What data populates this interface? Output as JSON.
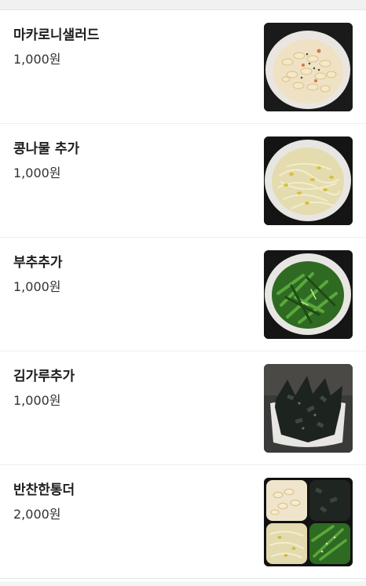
{
  "menu": {
    "items": [
      {
        "name": "마카로니샐러드",
        "price": "1,000원",
        "image": "macaroni-salad-photo"
      },
      {
        "name": "콩나물 추가",
        "price": "1,000원",
        "image": "bean-sprouts-photo"
      },
      {
        "name": "부추추가",
        "price": "1,000원",
        "image": "chives-photo"
      },
      {
        "name": "김가루추가",
        "price": "1,000원",
        "image": "seaweed-flakes-photo"
      },
      {
        "name": "반찬한통더",
        "price": "2,000원",
        "image": "side-dish-box-photo"
      }
    ]
  }
}
